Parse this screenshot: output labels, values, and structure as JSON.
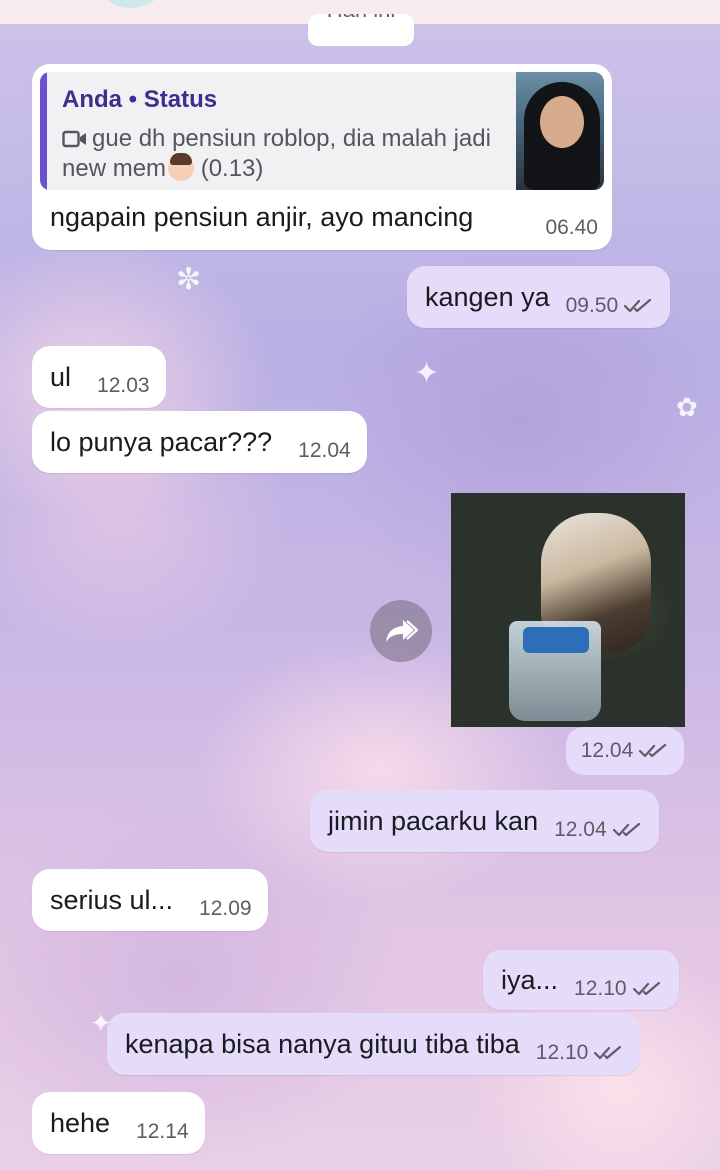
{
  "date_chip": "Hari ini",
  "reply": {
    "quote_author": "Anda • Status",
    "quote_icon": "video-icon",
    "quote_text": "gue dh pensiun roblop, dia malah jadi new mem",
    "quote_duration": "(0.13)",
    "text": "ngapain pensiun anjir, ayo mancing",
    "time": "06.40"
  },
  "messages": [
    {
      "text": "kangen ya",
      "time": "09.50",
      "direction": "out"
    },
    {
      "text": "ul",
      "time": "12.03",
      "direction": "in"
    },
    {
      "text": "lo punya pacar???",
      "time": "12.04",
      "direction": "in"
    },
    {
      "text": "jimin pacarku kan",
      "time": "12.04",
      "direction": "out"
    },
    {
      "text": "serius ul...",
      "time": "12.09",
      "direction": "in"
    },
    {
      "text": "iya...",
      "time": "12.10",
      "direction": "out"
    },
    {
      "text": "kenapa bisa nanya gituu tiba tiba",
      "time": "12.10",
      "direction": "out"
    },
    {
      "text": "hehe",
      "time": "12.14",
      "direction": "in"
    }
  ],
  "photo_message": {
    "time": "12.04",
    "direction": "out",
    "forward_icon": "forward-icon"
  },
  "colors": {
    "incoming_bubble": "#ffffff",
    "outgoing_bubble": "#e5dcfa",
    "quote_accent": "#6a4fd0",
    "tick": "#5d5d66"
  }
}
